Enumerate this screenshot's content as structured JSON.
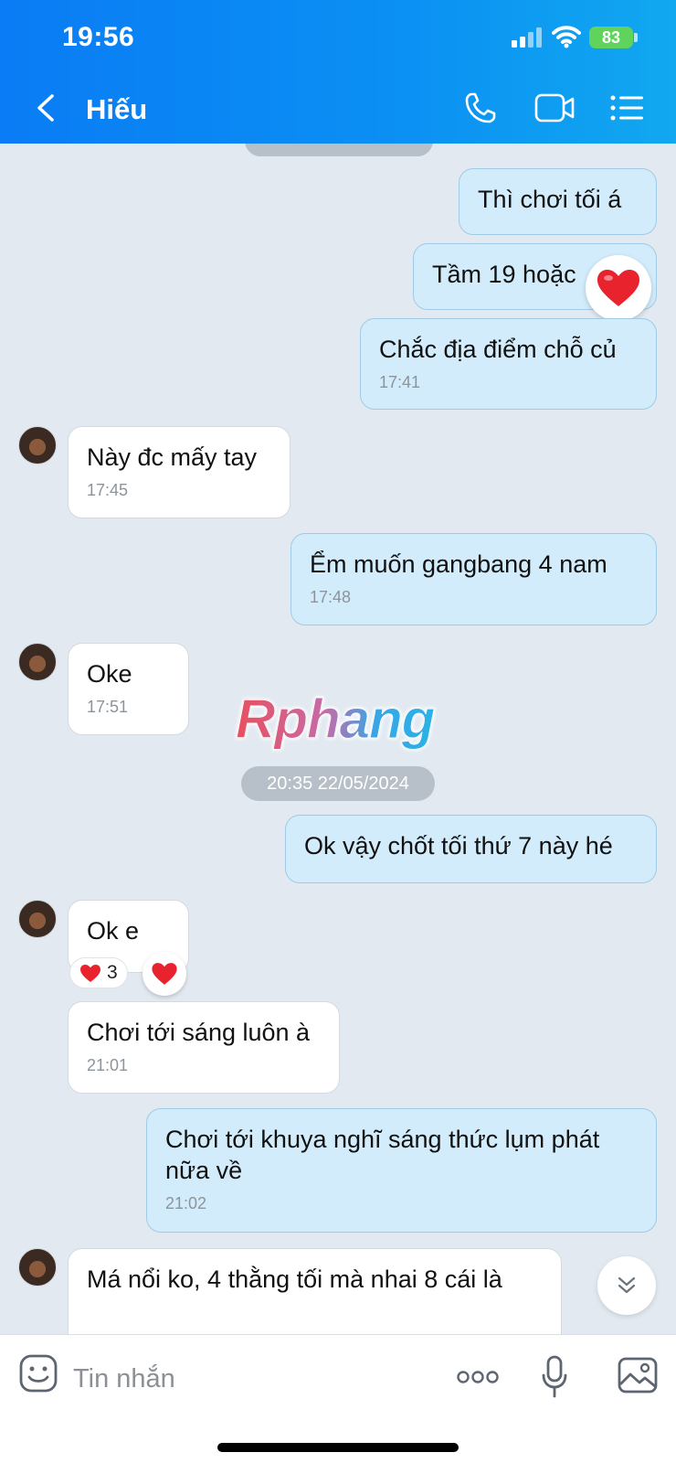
{
  "status_bar": {
    "time": "19:56",
    "battery": "83"
  },
  "header": {
    "title": "Hiếu"
  },
  "messages": [
    {
      "text": "Thì chơi tối á"
    },
    {
      "text": "Tầm 19 hoặc"
    },
    {
      "text": "Chắc địa điểm chỗ củ",
      "time": "17:41"
    },
    {
      "text": "Này đc mấy tay",
      "time": "17:45"
    },
    {
      "text": "Ểm muốn gangbang 4 nam",
      "time": "17:48"
    },
    {
      "text": "Oke",
      "time": "17:51"
    },
    {
      "text": "Ok vậy chốt tối thứ 7 này hé"
    },
    {
      "text": "Ok e",
      "reaction_count": "3"
    },
    {
      "text": "Chơi tới sáng luôn à",
      "time": "21:01"
    },
    {
      "text": "Chơi tới khuya nghĩ sáng thức lụm phát nữa về",
      "time": "21:02"
    },
    {
      "text": "Má nổi ko, 4 thằng tối mà nhai 8 cái là"
    }
  ],
  "date_divider": "20:35 22/05/2024",
  "watermark": "Rphang",
  "input": {
    "placeholder": "Tin nhắn"
  },
  "colors": {
    "header_start": "#0a7cf5",
    "header_end": "#11a8f0",
    "outgoing_bubble": "#d2ecfb",
    "chat_background": "#e2e9f1"
  },
  "icons": [
    "back-icon",
    "call-icon",
    "video-call-icon",
    "menu-icon",
    "heart-icon",
    "chevron-down-icon",
    "emoji-icon",
    "more-icon",
    "mic-icon",
    "image-icon"
  ]
}
